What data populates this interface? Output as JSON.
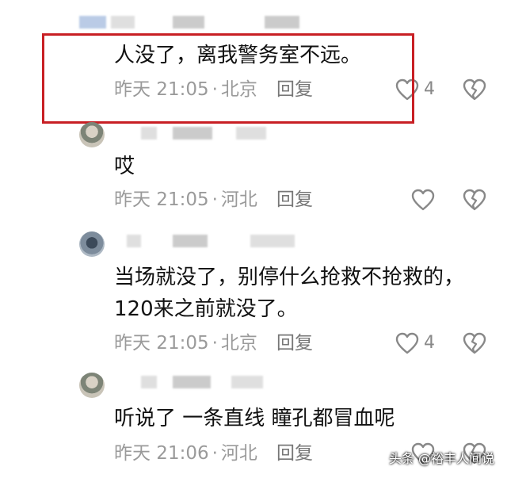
{
  "comments": [
    {
      "text": "人没了，离我警务室不远。",
      "time": "昨天 21:05",
      "location": "北京",
      "reply": "回复",
      "likes": "4"
    },
    {
      "text": "哎",
      "time": "昨天 21:05",
      "location": "河北",
      "reply": "回复",
      "likes": ""
    },
    {
      "text_line1": "当场就没了，别停什么抢救不抢救的，",
      "text_line2": "120来之前就没了。",
      "time": "昨天 21:05",
      "location": "北京",
      "reply": "回复",
      "likes": "4"
    },
    {
      "text": "听说了 一条直线 瞳孔都冒血呢",
      "time": "昨天 21:06",
      "location": "河北",
      "reply": "回复",
      "likes": ""
    }
  ],
  "meta_separator": "·",
  "watermark": "头条 @裕丰人间说",
  "icons": {
    "like": "heart-outline-icon",
    "dislike": "broken-heart-icon"
  },
  "colors": {
    "highlight": "#c81f24",
    "meta": "#9a9a9a"
  }
}
